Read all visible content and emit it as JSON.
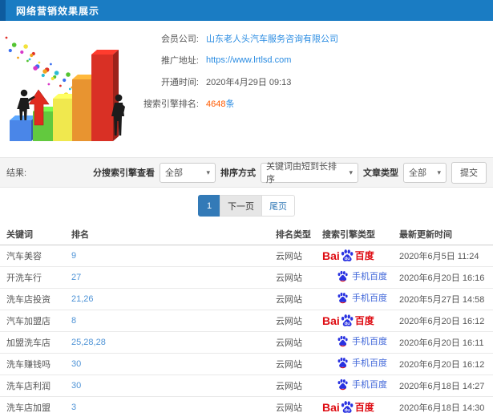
{
  "header": {
    "title": "网络营销效果展示"
  },
  "info": {
    "rows": [
      {
        "label": "会员公司:",
        "value": "山东老人头汽车服务咨询有限公司",
        "type": "link",
        "name": "member-company"
      },
      {
        "label": "推广地址:",
        "value": "https://www.lrtlsd.com",
        "type": "link",
        "name": "promotion-url"
      },
      {
        "label": "开通时间:",
        "value": "2020年4月29日 09:13",
        "type": "text",
        "name": "open-time"
      },
      {
        "label": "搜索引擎排名:",
        "value": "4648",
        "suffix": "条",
        "type": "highlight",
        "name": "engine-rank-count"
      }
    ]
  },
  "filters": {
    "result_label": "结果:",
    "engine_label": "分搜索引擎查看",
    "engine_value": "全部",
    "sort_label": "排序方式",
    "sort_value": "关键词由短到长排序",
    "article_label": "文章类型",
    "article_value": "全部",
    "submit_label": "提交",
    "caret": "▾"
  },
  "pagination": {
    "current": "1",
    "next": "下一页",
    "last": "尾页"
  },
  "table": {
    "headers": [
      "关键词",
      "排名",
      "排名类型",
      "搜索引擎类型",
      "最新更新时间"
    ],
    "rows": [
      {
        "keyword": "汽车美容",
        "rank": "9",
        "rank_type": "云网站",
        "engine": "baidu",
        "updated": "2020年6月5日 11:24"
      },
      {
        "keyword": "开洗车行",
        "rank": "27",
        "rank_type": "云网站",
        "engine": "shouji",
        "updated": "2020年6月20日 16:16"
      },
      {
        "keyword": "洗车店投资",
        "rank": "21,26",
        "rank_type": "云网站",
        "engine": "shouji",
        "updated": "2020年5月27日 14:58"
      },
      {
        "keyword": "汽车加盟店",
        "rank": "8",
        "rank_type": "云网站",
        "engine": "baidu",
        "updated": "2020年6月20日 16:12"
      },
      {
        "keyword": "加盟洗车店",
        "rank": "25,28,28",
        "rank_type": "云网站",
        "engine": "shouji",
        "updated": "2020年6月20日 16:11"
      },
      {
        "keyword": "洗车赚钱吗",
        "rank": "30",
        "rank_type": "云网站",
        "engine": "shouji",
        "updated": "2020年6月20日 16:12"
      },
      {
        "keyword": "洗车店利润",
        "rank": "30",
        "rank_type": "云网站",
        "engine": "shouji",
        "updated": "2020年6月18日 14:27"
      },
      {
        "keyword": "洗车店加盟",
        "rank": "3",
        "rank_type": "云网站",
        "engine": "baidu",
        "updated": "2020年6月18日 14:30"
      }
    ]
  },
  "engine_logos": {
    "baidu": {
      "prefix": "Bai",
      "du": "du",
      "suffix": "百度",
      "icon": "baidu-paw-icon"
    },
    "shouji": {
      "label": "手机百度",
      "icon": "mobile-baidu-paw-icon"
    }
  },
  "colors": {
    "header_blue": "#1a7cc3",
    "header_dark": "#0e5c9f",
    "link_blue": "#2a8ce2",
    "rank_blue": "#4e93d6",
    "highlight_orange": "#ff5a00",
    "pagination_blue": "#337ab7",
    "baidu_red": "#de0b12",
    "baidu_blue": "#2932e1",
    "mobile_blue": "#3c63d8",
    "bar_colors": [
      "#4a86e8",
      "#62c93e",
      "#f0e84e",
      "#e89430",
      "#d93025"
    ]
  }
}
